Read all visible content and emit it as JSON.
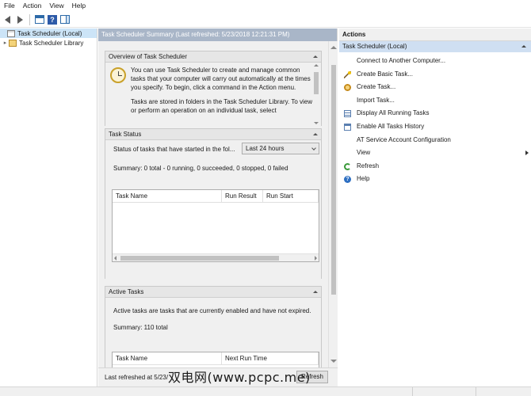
{
  "menu": [
    "File",
    "Action",
    "View",
    "Help"
  ],
  "toolbar": {
    "icons": [
      "back-arrow-icon",
      "forward-arrow-icon",
      "console-tree-icon",
      "help-icon",
      "show-hide-pane-icon"
    ]
  },
  "tree": {
    "items": [
      {
        "label": "Task Scheduler (Local)",
        "selected": true
      },
      {
        "label": "Task Scheduler Library",
        "selected": false
      }
    ]
  },
  "center": {
    "header": "Task Scheduler Summary (Last refreshed: 5/23/2018 12:21:31 PM)",
    "overview": {
      "title": "Overview of Task Scheduler",
      "para1": "You can use Task Scheduler to create and manage common tasks that your computer will carry out automatically at the times you specify. To begin, click a command in the Action menu.",
      "para2": "Tasks are stored in folders in the Task Scheduler Library. To view or perform an operation on an individual task, select"
    },
    "task_status": {
      "title": "Task Status",
      "label": "Status of tasks that have started in the fol...",
      "range_value": "Last 24 hours",
      "summary": "Summary: 0 total - 0 running, 0 succeeded, 0 stopped, 0 failed",
      "columns": [
        "Task Name",
        "Run Result",
        "Run Start"
      ]
    },
    "active_tasks": {
      "title": "Active Tasks",
      "description": "Active tasks are tasks that are currently enabled and have not expired.",
      "summary": "Summary: 110 total",
      "columns": [
        "Task Name",
        "Next Run Time"
      ]
    },
    "footer": {
      "last_refreshed": "Last refreshed at 5/23/",
      "refresh_button": "Refresh"
    }
  },
  "actions": {
    "title": "Actions",
    "subheader": "Task Scheduler (Local)",
    "items": [
      {
        "label": "Connect to Another Computer...",
        "icon": ""
      },
      {
        "label": "Create Basic Task...",
        "icon": "wand-icon"
      },
      {
        "label": "Create Task...",
        "icon": "task-icon"
      },
      {
        "label": "Import Task...",
        "icon": ""
      },
      {
        "label": "Display All Running Tasks",
        "icon": "list-icon"
      },
      {
        "label": "Enable All Tasks History",
        "icon": "history-icon"
      },
      {
        "label": "AT Service Account Configuration",
        "icon": ""
      },
      {
        "label": "View",
        "icon": "",
        "submenu": true
      },
      {
        "label": "Refresh",
        "icon": "refresh-icon"
      },
      {
        "label": "Help",
        "icon": "help-icon"
      }
    ]
  },
  "watermark": "双电网(www.pcpc.me)"
}
